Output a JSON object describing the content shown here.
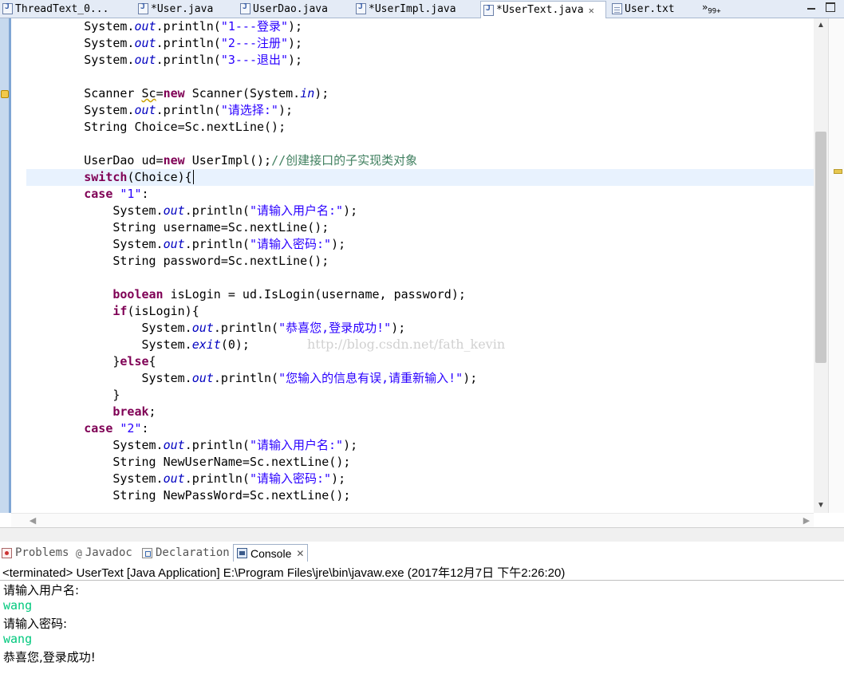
{
  "editor_tabs": [
    {
      "label": "ThreadText_0...",
      "icon": "java-file-icon",
      "active": false
    },
    {
      "label": "*User.java",
      "icon": "java-file-icon",
      "active": false
    },
    {
      "label": "UserDao.java",
      "icon": "java-file-icon",
      "active": false
    },
    {
      "label": "*UserImpl.java",
      "icon": "java-file-icon",
      "active": false
    },
    {
      "label": "*UserText.java",
      "icon": "java-file-icon",
      "active": true,
      "close": "✕"
    },
    {
      "label": "User.txt",
      "icon": "text-file-icon",
      "active": false
    }
  ],
  "overflow": {
    "chevron": "»",
    "count": "99+"
  },
  "code": {
    "lines": [
      [
        {
          "t": "        System."
        },
        {
          "t": "out",
          "c": "fld"
        },
        {
          "t": ".println("
        },
        {
          "t": "\"1---登录\"",
          "c": "str"
        },
        {
          "t": ");"
        }
      ],
      [
        {
          "t": "        System."
        },
        {
          "t": "out",
          "c": "fld"
        },
        {
          "t": ".println("
        },
        {
          "t": "\"2---注册\"",
          "c": "str"
        },
        {
          "t": ");"
        }
      ],
      [
        {
          "t": "        System."
        },
        {
          "t": "out",
          "c": "fld"
        },
        {
          "t": ".println("
        },
        {
          "t": "\"3---退出\"",
          "c": "str"
        },
        {
          "t": ");"
        }
      ],
      [
        {
          "t": ""
        }
      ],
      [
        {
          "t": "        Scanner "
        },
        {
          "t": "Sc",
          "c": "wv"
        },
        {
          "t": "="
        },
        {
          "t": "new",
          "c": "kw"
        },
        {
          "t": " Scanner(System."
        },
        {
          "t": "in",
          "c": "fld"
        },
        {
          "t": ");"
        }
      ],
      [
        {
          "t": "        System."
        },
        {
          "t": "out",
          "c": "fld"
        },
        {
          "t": ".println("
        },
        {
          "t": "\"请选择:\"",
          "c": "str"
        },
        {
          "t": ");"
        }
      ],
      [
        {
          "t": "        String Choice=Sc.nextLine();"
        }
      ],
      [
        {
          "t": ""
        }
      ],
      [
        {
          "t": "        UserDao ud="
        },
        {
          "t": "new",
          "c": "kw"
        },
        {
          "t": " UserImpl();"
        },
        {
          "t": "//创建接口的子实现类对象",
          "c": "cmt"
        }
      ],
      [
        {
          "t": "        "
        },
        {
          "t": "switch",
          "c": "kw"
        },
        {
          "t": "(Choice){"
        },
        {
          "t": "",
          "c": "caret"
        }
      ],
      [
        {
          "t": "        "
        },
        {
          "t": "case",
          "c": "kw"
        },
        {
          "t": " "
        },
        {
          "t": "\"1\"",
          "c": "str"
        },
        {
          "t": ":"
        }
      ],
      [
        {
          "t": "            System."
        },
        {
          "t": "out",
          "c": "fld"
        },
        {
          "t": ".println("
        },
        {
          "t": "\"请输入用户名:\"",
          "c": "str"
        },
        {
          "t": ");"
        }
      ],
      [
        {
          "t": "            String username=Sc.nextLine();"
        }
      ],
      [
        {
          "t": "            System."
        },
        {
          "t": "out",
          "c": "fld"
        },
        {
          "t": ".println("
        },
        {
          "t": "\"请输入密码:\"",
          "c": "str"
        },
        {
          "t": ");"
        }
      ],
      [
        {
          "t": "            String password=Sc.nextLine();"
        }
      ],
      [
        {
          "t": ""
        }
      ],
      [
        {
          "t": "            "
        },
        {
          "t": "boolean",
          "c": "kw"
        },
        {
          "t": " isLogin = ud.IsLogin(username, password);"
        }
      ],
      [
        {
          "t": "            "
        },
        {
          "t": "if",
          "c": "kw"
        },
        {
          "t": "(isLogin){"
        }
      ],
      [
        {
          "t": "                System."
        },
        {
          "t": "out",
          "c": "fld"
        },
        {
          "t": ".println("
        },
        {
          "t": "\"恭喜您,登录成功!\"",
          "c": "str"
        },
        {
          "t": ");"
        }
      ],
      [
        {
          "t": "                System."
        },
        {
          "t": "exit",
          "c": "fld"
        },
        {
          "t": "(0);"
        }
      ],
      [
        {
          "t": "            }"
        },
        {
          "t": "else",
          "c": "kw"
        },
        {
          "t": "{"
        }
      ],
      [
        {
          "t": "                System."
        },
        {
          "t": "out",
          "c": "fld"
        },
        {
          "t": ".println("
        },
        {
          "t": "\"您输入的信息有误,请重新输入!\"",
          "c": "str"
        },
        {
          "t": ");"
        }
      ],
      [
        {
          "t": "            }"
        }
      ],
      [
        {
          "t": "            "
        },
        {
          "t": "break",
          "c": "kw"
        },
        {
          "t": ";"
        }
      ],
      [
        {
          "t": "        "
        },
        {
          "t": "case",
          "c": "kw"
        },
        {
          "t": " "
        },
        {
          "t": "\"2\"",
          "c": "str"
        },
        {
          "t": ":"
        }
      ],
      [
        {
          "t": "            System."
        },
        {
          "t": "out",
          "c": "fld"
        },
        {
          "t": ".println("
        },
        {
          "t": "\"请输入用户名:\"",
          "c": "str"
        },
        {
          "t": ");"
        }
      ],
      [
        {
          "t": "            String NewUserName=Sc.nextLine();"
        }
      ],
      [
        {
          "t": "            System."
        },
        {
          "t": "out",
          "c": "fld"
        },
        {
          "t": ".println("
        },
        {
          "t": "\"请输入密码:\"",
          "c": "str"
        },
        {
          "t": ");"
        }
      ],
      [
        {
          "t": "            String NewPassWord=Sc.nextLine();"
        }
      ]
    ],
    "current_line": 9
  },
  "watermark": "http://blog.csdn.net/fath_kevin",
  "scroll": {
    "up": "▲",
    "down": "▼",
    "left": "◀",
    "right": "▶"
  },
  "view_tabs": [
    {
      "label": "Problems",
      "icon": "problems-icon",
      "active": false
    },
    {
      "label": "Javadoc",
      "icon": "at-icon",
      "active": false
    },
    {
      "label": "Declaration",
      "icon": "declaration-icon",
      "active": false
    },
    {
      "label": "Console",
      "icon": "console-icon",
      "active": true,
      "close": "✕"
    }
  ],
  "console": {
    "status": "<terminated> UserText [Java Application] E:\\Program Files\\jre\\bin\\javaw.exe (2017年12月7日 下午2:26:20)",
    "lines": [
      {
        "text": "请输入用户名:",
        "input": false
      },
      {
        "text": "wang",
        "input": true
      },
      {
        "text": "请输入密码:",
        "input": false
      },
      {
        "text": "wang",
        "input": true
      },
      {
        "text": "恭喜您,登录成功!",
        "input": false
      }
    ]
  }
}
